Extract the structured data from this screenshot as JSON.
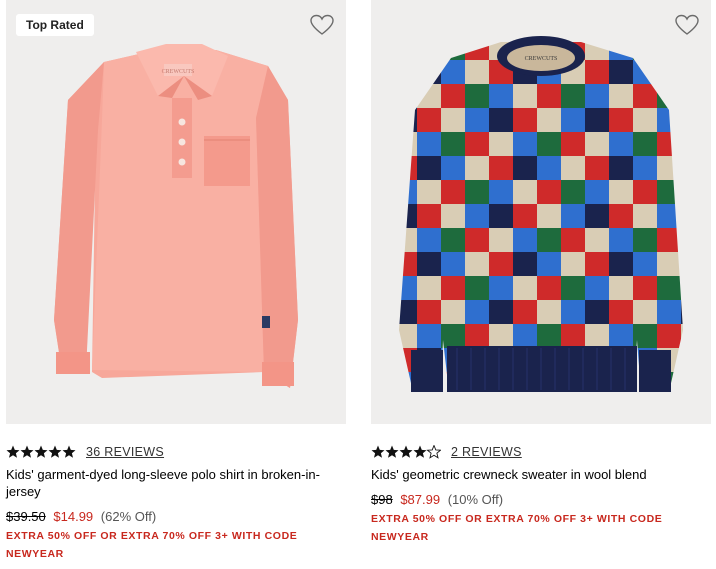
{
  "products": [
    {
      "badge": "Top Rated",
      "rating": 5,
      "reviews_label": "36 REVIEWS",
      "title": "Kids' garment-dyed long-sleeve polo shirt in broken-in-jersey",
      "original_price": "$39.50",
      "sale_price": "$14.99",
      "percent_off": "(62% Off)",
      "promo": "EXTRA 50% OFF OR EXTRA 70% OFF 3+ WITH CODE NEWYEAR",
      "image_label": "CREWCUTS",
      "icon": "heart-icon"
    },
    {
      "rating": 4.5,
      "reviews_label": "2 REVIEWS",
      "title": "Kids' geometric crewneck sweater in wool blend",
      "original_price": "$98",
      "sale_price": "$87.99",
      "percent_off": "(10% Off)",
      "promo": "EXTRA 50% OFF OR EXTRA 70% OFF 3+ WITH CODE NEWYEAR",
      "image_label": "CREWCUTS",
      "icon": "heart-icon"
    }
  ],
  "colors": {
    "sale_red": "#c8281e",
    "image_bg": "#efeeed",
    "polo_pink": "#f7a79a"
  }
}
